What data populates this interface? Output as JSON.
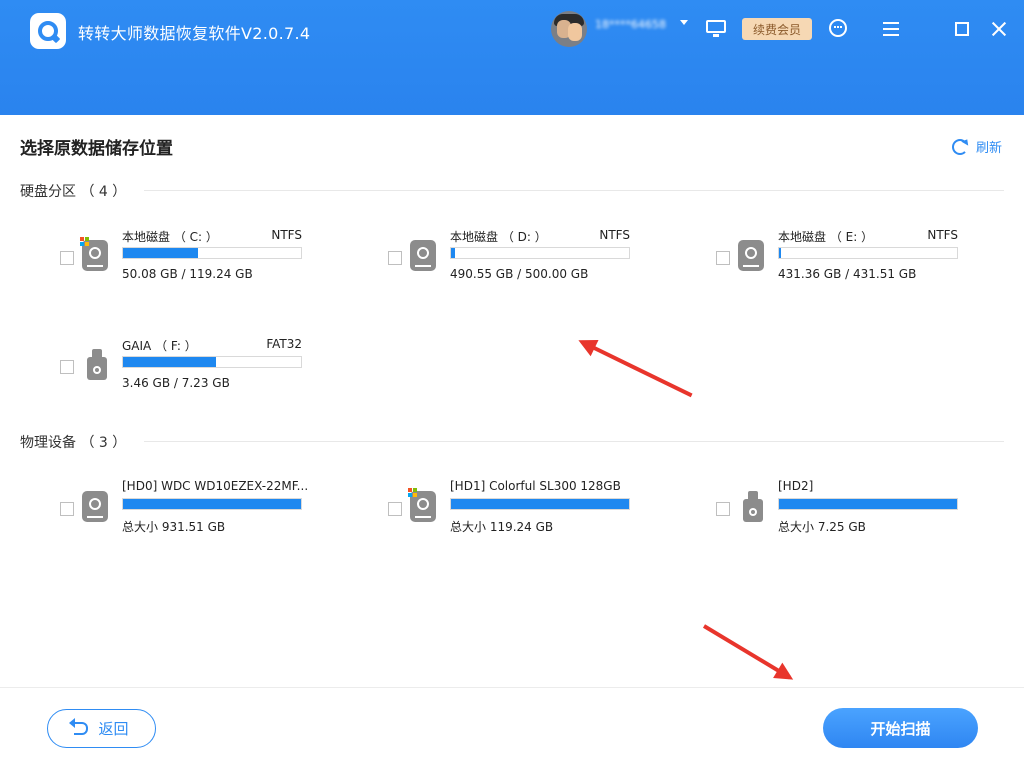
{
  "header": {
    "app_title": "转转大师数据恢复软件V2.0.7.4",
    "username": "18****64658",
    "vip_label": "续费会员"
  },
  "page": {
    "title": "选择原数据储存位置",
    "refresh_label": "刷新"
  },
  "partitions": {
    "title": "硬盘分区 （ 4 ）",
    "items": [
      {
        "name": "本地磁盘 （ C: ）",
        "fs": "NTFS",
        "size": "50.08 GB / 119.24 GB",
        "used_pct": 42,
        "icon": "hdd-icon",
        "windows": true
      },
      {
        "name": "本地磁盘 （ D: ）",
        "fs": "NTFS",
        "size": "490.55 GB / 500.00 GB",
        "used_pct": 2,
        "icon": "hdd-icon",
        "windows": false
      },
      {
        "name": "本地磁盘 （ E: ）",
        "fs": "NTFS",
        "size": "431.36 GB / 431.51 GB",
        "used_pct": 1,
        "icon": "hdd-icon",
        "windows": false
      },
      {
        "name": "GAIA （ F: ）",
        "fs": "FAT32",
        "size": "3.46 GB / 7.23 GB",
        "used_pct": 52,
        "icon": "usb-drive-icon",
        "windows": false
      }
    ]
  },
  "devices": {
    "title": "物理设备 （ 3 ）",
    "items": [
      {
        "name": "[HD0] WDC WD10EZEX-22MF...",
        "size": "总大小 931.51 GB",
        "used_pct": 100,
        "icon": "hdd-icon",
        "windows": false
      },
      {
        "name": "[HD1] Colorful SL300 128GB",
        "size": "总大小 119.24 GB",
        "used_pct": 100,
        "icon": "hdd-icon",
        "windows": true
      },
      {
        "name": "[HD2]",
        "size": "总大小 7.25 GB",
        "used_pct": 100,
        "icon": "usb-drive-icon",
        "windows": false
      }
    ]
  },
  "footer": {
    "back_label": "返回",
    "scan_label": "开始扫描"
  },
  "colors": {
    "header_blue": "#2f8cf3",
    "progress_blue": "#1e88f0",
    "annotation_red": "#e8352c"
  }
}
